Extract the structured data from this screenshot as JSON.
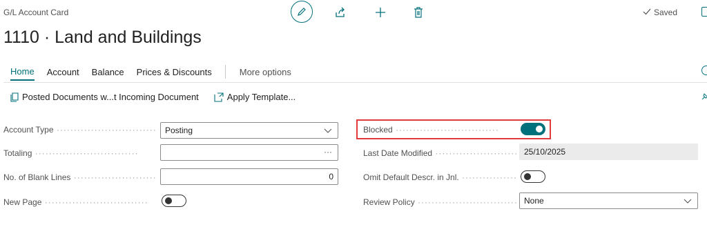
{
  "header": {
    "breadcrumb": "G/L Account Card",
    "title": "1110 · Land and Buildings",
    "saved_label": "Saved",
    "icons": [
      "edit-icon",
      "share-icon",
      "add-icon",
      "delete-icon",
      "checkmark-icon"
    ]
  },
  "tabs": {
    "items": [
      {
        "label": "Home",
        "active": true
      },
      {
        "label": "Account"
      },
      {
        "label": "Balance"
      },
      {
        "label": "Prices & Discounts"
      }
    ],
    "more_label": "More options"
  },
  "actions": {
    "posted_docs": "Posted Documents w...t Incoming Document",
    "apply_template": "Apply Template..."
  },
  "fields_left": {
    "account_type": {
      "label": "Account Type",
      "value": "Posting"
    },
    "totaling": {
      "label": "Totaling",
      "value": ""
    },
    "blank_lines": {
      "label": "No. of Blank Lines",
      "value": "0"
    },
    "new_page": {
      "label": "New Page",
      "value": false
    }
  },
  "fields_right": {
    "blocked": {
      "label": "Blocked",
      "value": true
    },
    "last_modified": {
      "label": "Last Date Modified",
      "value": "25/10/2025"
    },
    "omit_descr": {
      "label": "Omit Default Descr. in Jnl.",
      "value": false
    },
    "review_policy": {
      "label": "Review Policy",
      "value": "None"
    }
  },
  "colors": {
    "accent": "#00707a",
    "highlight": "#e03a3a"
  }
}
